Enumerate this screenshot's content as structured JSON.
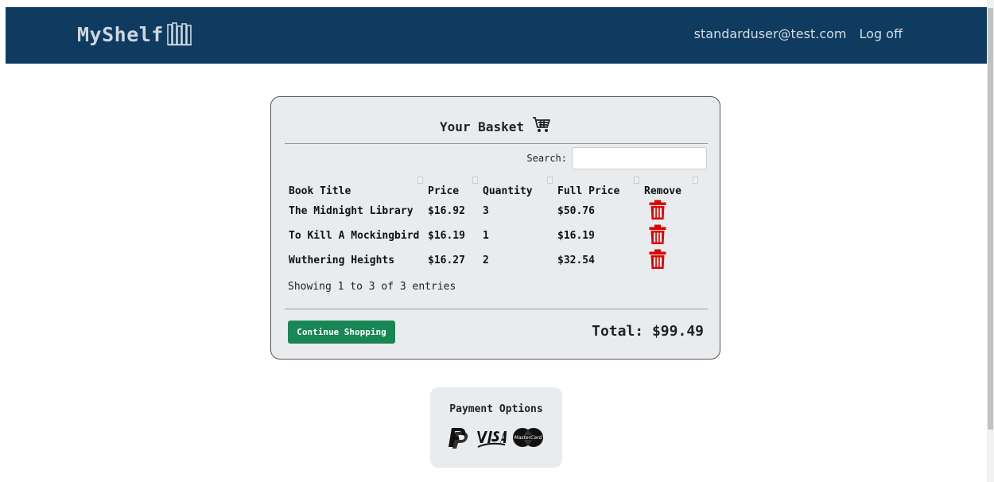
{
  "navbar": {
    "brand": "MyShelf",
    "brand_icon": "books-icon",
    "user_email": "standarduser@test.com",
    "logoff_label": "Log off",
    "background": "#0e3b5f"
  },
  "basket": {
    "title": "Your Basket",
    "title_icon": "shopping-cart-icon",
    "search_label": "Search:",
    "search_value": "",
    "columns": [
      "Book Title",
      "Price",
      "Quantity",
      "Full Price",
      "Remove"
    ],
    "rows": [
      {
        "title": "The Midnight Library",
        "price": "$16.92",
        "quantity": "3",
        "full_price": "$50.76"
      },
      {
        "title": "To Kill A Mockingbird",
        "price": "$16.19",
        "quantity": "1",
        "full_price": "$16.19"
      },
      {
        "title": "Wuthering Heights",
        "price": "$16.27",
        "quantity": "2",
        "full_price": "$32.54"
      }
    ],
    "remove_icon": "trash-icon",
    "remove_color": "#e00000",
    "showing_text": "Showing 1 to 3 of 3 entries",
    "continue_label": "Continue Shopping",
    "continue_color": "#198754",
    "total_text": "Total: $99.49"
  },
  "payment": {
    "title": "Payment Options",
    "icons": [
      "paypal-icon",
      "visa-icon",
      "mastercard-icon"
    ]
  }
}
